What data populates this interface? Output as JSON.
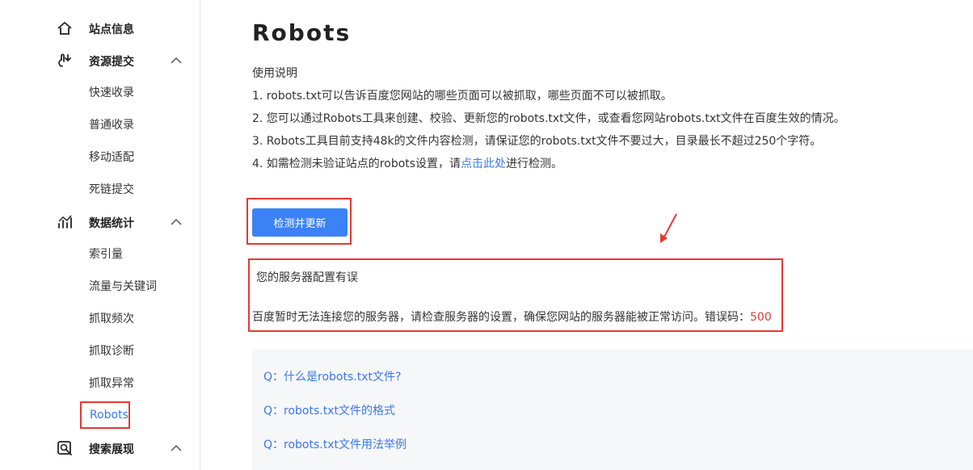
{
  "sidebar": {
    "sections": [
      {
        "label": "站点信息",
        "icon": "home-icon"
      },
      {
        "label": "资源提交",
        "icon": "submit-icon",
        "expanded": true,
        "items": [
          "快速收录",
          "普通收录",
          "移动适配",
          "死链提交"
        ]
      },
      {
        "label": "数据统计",
        "icon": "stats-icon",
        "expanded": true,
        "items": [
          "索引量",
          "流量与关键词",
          "抓取频次",
          "抓取诊断",
          "抓取异常",
          "Robots"
        ]
      },
      {
        "label": "搜索展现",
        "icon": "search-display-icon",
        "expanded": true
      }
    ],
    "active_item": "Robots"
  },
  "main": {
    "title": "Robots",
    "usage_title": "使用说明",
    "instructions": [
      "1. robots.txt可以告诉百度您网站的哪些页面可以被抓取，哪些页面不可以被抓取。",
      "2. 您可以通过Robots工具来创建、校验、更新您的robots.txt文件，或查看您网站robots.txt文件在百度生效的情况。",
      "3. Robots工具目前支持48k的文件内容检测，请保证您的robots.txt文件不要过大，目录最长不超过250个字符。"
    ],
    "instruction4_prefix": "4. 如需检测未验证站点的robots设置，请",
    "instruction4_link": "点击此处",
    "instruction4_suffix": "进行检测。",
    "check_button": "检测并更新",
    "error": {
      "title": "您的服务器配置有误",
      "message": "百度暂时无法连接您的服务器，请检查服务器的设置，确保您网站的服务器能被正常访问。错误码：",
      "code": "500"
    },
    "faq": [
      "Q：什么是robots.txt文件?",
      "Q：robots.txt文件的格式",
      "Q：robots.txt文件用法举例"
    ]
  },
  "colors": {
    "accent": "#3b82f6",
    "link": "#3b78e7",
    "highlight": "#e53935",
    "error_code": "#e53935"
  }
}
